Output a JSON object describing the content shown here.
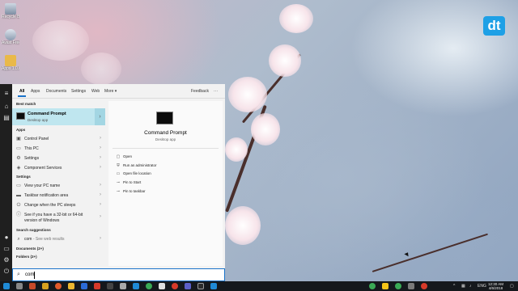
{
  "desktop": {
    "icons": [
      {
        "label": "Recycle Bin"
      },
      {
        "label": "Avast Free"
      },
      {
        "label": "Apps 1.0.0"
      }
    ],
    "brand_badge": "dt"
  },
  "search_panel": {
    "tabs": [
      {
        "label": "All",
        "active": true
      },
      {
        "label": "Apps"
      },
      {
        "label": "Documents"
      },
      {
        "label": "Settings"
      },
      {
        "label": "Web"
      },
      {
        "label": "More ▾"
      }
    ],
    "feedback_label": "Feedback",
    "more_options_label": "···",
    "best_match": {
      "header": "Best match",
      "title": "Command Prompt",
      "subtitle": "Desktop app"
    },
    "apps": {
      "header": "Apps",
      "items": [
        {
          "label": "Control Panel"
        },
        {
          "label": "This PC"
        },
        {
          "label": "Settings"
        },
        {
          "label": "Component Services"
        }
      ]
    },
    "settings": {
      "header": "Settings",
      "items": [
        {
          "label": "View your PC name"
        },
        {
          "label": "Taskbar notification area"
        },
        {
          "label": "Change when the PC sleeps"
        },
        {
          "label": "See if you have a 32-bit or 64-bit",
          "label_line2": "version of Windows"
        }
      ]
    },
    "search_suggestions": {
      "header": "Search suggestions",
      "item": "com",
      "item_suffix": " - See web results"
    },
    "documents_header": "Documents (2+)",
    "folders_header": "Folders (2+)",
    "preview": {
      "title": "Command Prompt",
      "subtitle": "Desktop app",
      "actions": [
        {
          "label": "Open",
          "icon": "open-icon"
        },
        {
          "label": "Run as administrator",
          "icon": "shield-icon"
        },
        {
          "label": "Open file location",
          "icon": "folder-icon"
        },
        {
          "label": "Pin to Start",
          "icon": "pin-icon"
        },
        {
          "label": "Pin to taskbar",
          "icon": "pin-icon"
        }
      ]
    }
  },
  "search_box": {
    "value": "com"
  },
  "taskbar": {
    "language": "ENG",
    "time": "12:30 AM",
    "date": "4/6/2018"
  },
  "colors": {
    "accent": "#1a73c9",
    "best_match_bg": "#bfe6ef",
    "brand": "#1ea0e6",
    "taskbar": "#15181c"
  }
}
